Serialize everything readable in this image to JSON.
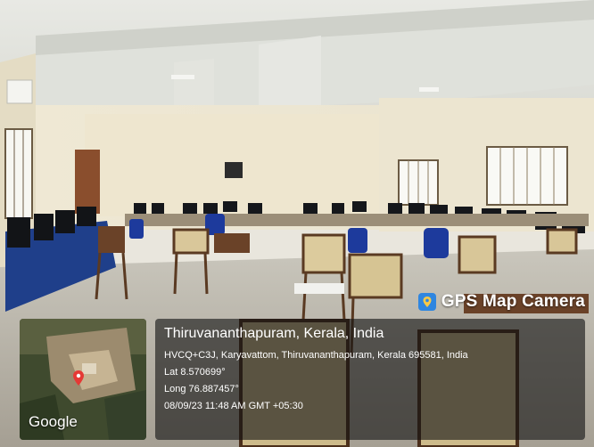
{
  "badge": {
    "title": "GPS Map Camera",
    "icon": "map-pin-icon"
  },
  "location": {
    "city": "Thiruvananthapuram, Kerala, India",
    "address": "HVCQ+C3J, Karyavattom, Thiruvananthapuram, Kerala 695581, India",
    "lat": "Lat 8.570699°",
    "long": "Long 76.887457°",
    "datetime": "08/09/23 11:48 AM GMT +05:30"
  },
  "map": {
    "brand": "Google",
    "marker_color": "#e53935"
  }
}
